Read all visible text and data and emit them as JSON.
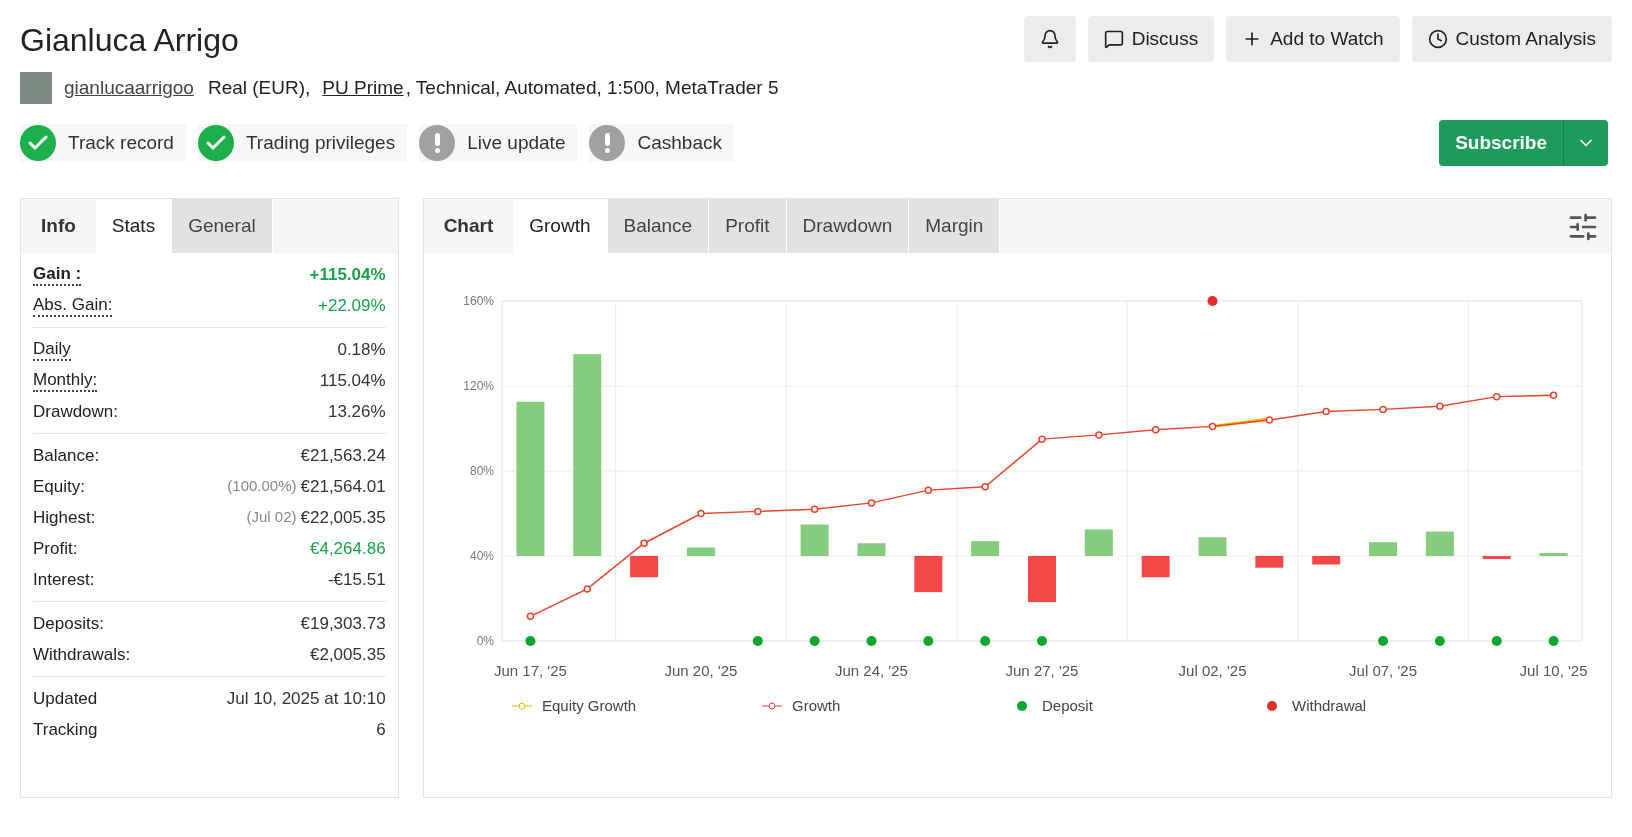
{
  "header": {
    "title": "Gianluca Arrigo",
    "username": "gianlucaarrigoo",
    "details": [
      {
        "text": "Real (EUR),",
        "link": false
      },
      {
        "text": "PU Prime",
        "link": true
      },
      {
        "text": ", Technical, Automated, 1:500, MetaTrader 5",
        "link": false
      }
    ]
  },
  "actions": [
    {
      "kind": "bell"
    },
    {
      "kind": "discuss",
      "label": "Discuss"
    },
    {
      "kind": "watch",
      "label": "Add to Watch"
    },
    {
      "kind": "analysis",
      "label": "Custom Analysis"
    }
  ],
  "badges": [
    {
      "label": "Track record",
      "verified": true
    },
    {
      "label": "Trading privileges",
      "verified": true
    },
    {
      "label": "Live update",
      "verified": false
    },
    {
      "label": "Cashback",
      "verified": false
    }
  ],
  "subscribe": {
    "label": "Subscribe"
  },
  "stats_panel": {
    "tabs": [
      {
        "label": "Info",
        "kind": "title"
      },
      {
        "label": "Stats",
        "kind": "tab",
        "selected": true
      },
      {
        "label": "General",
        "kind": "tab",
        "selected": false
      }
    ],
    "groups": [
      [
        {
          "label": "Gain :",
          "value": "+115.04%",
          "bold": true,
          "dotted": true,
          "positive": true
        },
        {
          "label": "Abs. Gain:",
          "value": "+22.09%",
          "bold": false,
          "dotted": true,
          "positive": true
        }
      ],
      [
        {
          "label": "Daily",
          "value": "0.18%",
          "bold": false,
          "dotted": true,
          "positive": false
        },
        {
          "label": "Monthly:",
          "value": "115.04%",
          "bold": false,
          "dotted": true,
          "positive": false
        },
        {
          "label": "Drawdown:",
          "value": "13.26%",
          "bold": false,
          "dotted": false,
          "positive": false
        }
      ],
      [
        {
          "label": "Balance:",
          "value": "€21,563.24",
          "bold": false,
          "dotted": false,
          "positive": false
        },
        {
          "label": "Equity:",
          "note": "(100.00%)",
          "value": "€21,564.01",
          "bold": false,
          "dotted": false,
          "positive": false
        },
        {
          "label": "Highest:",
          "note": "(Jul 02)",
          "value": "€22,005.35",
          "bold": false,
          "dotted": false,
          "positive": false
        },
        {
          "label": "Profit:",
          "value": "€4,264.86",
          "bold": false,
          "dotted": false,
          "positive": true
        },
        {
          "label": "Interest:",
          "value": "-€15.51",
          "bold": false,
          "dotted": false,
          "positive": false
        }
      ],
      [
        {
          "label": "Deposits:",
          "value": "€19,303.73",
          "bold": false,
          "dotted": false,
          "positive": false
        },
        {
          "label": "Withdrawals:",
          "value": "€2,005.35",
          "bold": false,
          "dotted": false,
          "positive": false
        }
      ],
      [
        {
          "label": "Updated",
          "value": "Jul 10, 2025 at 10:10",
          "bold": false,
          "dotted": false,
          "positive": false
        },
        {
          "label": "Tracking",
          "value": "6",
          "bold": false,
          "dotted": false,
          "positive": false
        }
      ]
    ]
  },
  "chart_panel": {
    "tabs": [
      {
        "label": "Chart",
        "kind": "title"
      },
      {
        "label": "Growth",
        "kind": "tab",
        "selected": true
      },
      {
        "label": "Balance",
        "kind": "tab",
        "selected": false
      },
      {
        "label": "Profit",
        "kind": "tab",
        "selected": false
      },
      {
        "label": "Drawdown",
        "kind": "tab",
        "selected": false
      },
      {
        "label": "Margin",
        "kind": "tab",
        "selected": false
      }
    ],
    "chart_data": {
      "type": "bar",
      "categories": [
        "Jun 17, '25",
        null,
        null,
        "Jun 20, '25",
        null,
        null,
        "Jun 24, '25",
        null,
        null,
        "Jun 27, '25",
        null,
        null,
        "Jul 02, '25",
        null,
        null,
        "Jul 07, '25",
        null,
        null,
        "Jul 10, '25"
      ],
      "ylim": [
        0,
        160
      ],
      "grid": true,
      "legend": "bottom",
      "yticks": [
        {
          "value": 0,
          "label": "0%"
        },
        {
          "value": 40,
          "label": "40%"
        },
        {
          "value": 80,
          "label": "80%"
        },
        {
          "value": 120,
          "label": "120%"
        },
        {
          "value": 160,
          "label": "160%"
        }
      ],
      "series": [
        {
          "type": "bar",
          "color": "#86cc7e",
          "base": [
            40,
            40,
            null,
            40,
            null,
            40,
            40,
            null,
            40,
            null,
            40,
            null,
            40,
            null,
            null,
            40,
            40,
            null,
            40
          ],
          "values": [
            72.6,
            95,
            null,
            4,
            null,
            14.8,
            6,
            null,
            7,
            null,
            12.5,
            null,
            8.8,
            null,
            null,
            6.5,
            11.5,
            null,
            1.4
          ]
        },
        {
          "type": "bar",
          "color": "#f44848",
          "base": [
            null,
            null,
            40,
            null,
            null,
            null,
            null,
            40,
            null,
            40,
            null,
            40,
            null,
            40,
            40,
            null,
            null,
            40,
            null
          ],
          "values": [
            null,
            null,
            -10,
            null,
            null,
            null,
            null,
            -17,
            null,
            -21.7,
            null,
            -10,
            null,
            -5.5,
            -4,
            null,
            null,
            -1.4,
            null
          ]
        },
        {
          "type": "line",
          "name": "Equity Growth",
          "color": "#f0b400",
          "values": [
            null,
            null,
            null,
            null,
            null,
            null,
            null,
            null,
            null,
            null,
            null,
            null,
            101,
            104.5,
            null,
            null,
            null,
            null,
            null
          ]
        },
        {
          "type": "line",
          "name": "Growth",
          "color": "#e8452c",
          "marker": "circle",
          "values": [
            11.6,
            24.5,
            46,
            60,
            61,
            62,
            65,
            71,
            72.6,
            95,
            97,
            99.4,
            101,
            104,
            108,
            109,
            110.5,
            115,
            115.6
          ]
        },
        {
          "type": "scatter",
          "name": "Deposit",
          "color": "#0ca52e",
          "values": [
            0,
            null,
            null,
            null,
            0,
            0,
            0,
            0,
            0,
            0,
            null,
            null,
            null,
            null,
            null,
            0,
            0,
            0,
            0
          ]
        },
        {
          "type": "scatter",
          "name": "Withdrawal",
          "color": "#e52f2f",
          "values": [
            null,
            null,
            null,
            null,
            null,
            null,
            null,
            null,
            null,
            null,
            null,
            null,
            160,
            null,
            null,
            null,
            null,
            null,
            null
          ]
        }
      ]
    }
  }
}
